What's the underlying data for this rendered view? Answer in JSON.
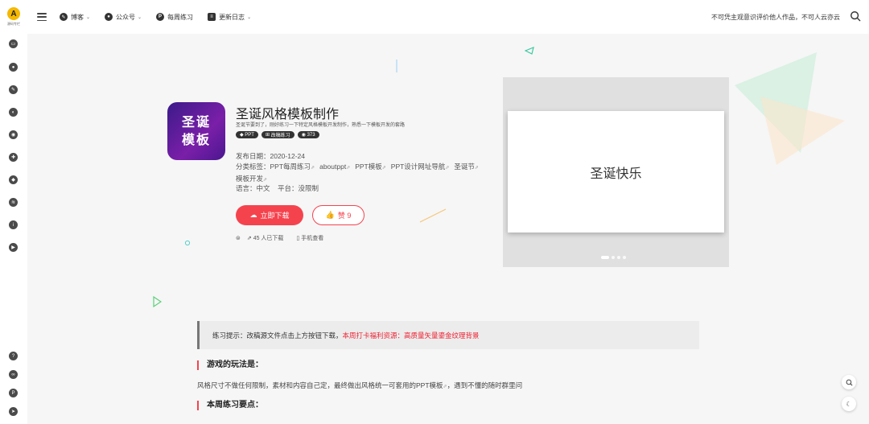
{
  "header": {
    "logo_text": "源码专栏",
    "nav": [
      {
        "label": "博客",
        "icon": "pen-icon",
        "caret": true
      },
      {
        "label": "公众号",
        "icon": "wechat-icon",
        "caret": true
      },
      {
        "label": "每周练习",
        "icon": "p-icon",
        "caret": false
      },
      {
        "label": "更新日志",
        "icon": "log-icon",
        "caret": true
      }
    ],
    "slogan": "不可凭主观意识评价他人作品，不可人云亦云"
  },
  "product": {
    "cover_line1": "圣诞",
    "cover_line2": "模板",
    "title": "圣诞风格模板制作",
    "description": "圣诞节要到了，刚好练习一下特定风格模板开发制作，熟悉一下模板开发的套路",
    "badges": [
      "PPT",
      "改稿练习",
      "373"
    ],
    "publish_date": "发布日期：2020-12-24",
    "category_label": "分类标签：",
    "tags": [
      "PPT每周练习",
      "aboutppt",
      "PPT模板",
      "PPT设计网址导航",
      "圣诞节",
      "模板开发"
    ],
    "language": "语言：中文",
    "platform": "平台：没限制",
    "download_label": "立即下载",
    "like_label": "赞 9",
    "downloads": "45 人已下载",
    "mobile_view": "手机查看"
  },
  "preview": {
    "slide_text": "圣诞快乐",
    "slide_count": 4,
    "active_slide": 1
  },
  "content": {
    "tip_prefix": "练习提示：改稿源文件点击上方按钮下载，",
    "tip_link": "本周打卡福利资源：高质量矢量鎏金纹理背景",
    "section1_title": "游戏的玩法是：",
    "section1_text": "风格尺寸不做任何限制，素材和内容自己定，最终做出风格统一可套用的PPT模板",
    "section1_text_suffix": "，遇到不懂的随时群里问",
    "section2_title": "本周练习要点："
  },
  "colors": {
    "accent": "#f5434e",
    "cover_start": "#3b1a8a",
    "cover_end": "#7a1fa8"
  }
}
